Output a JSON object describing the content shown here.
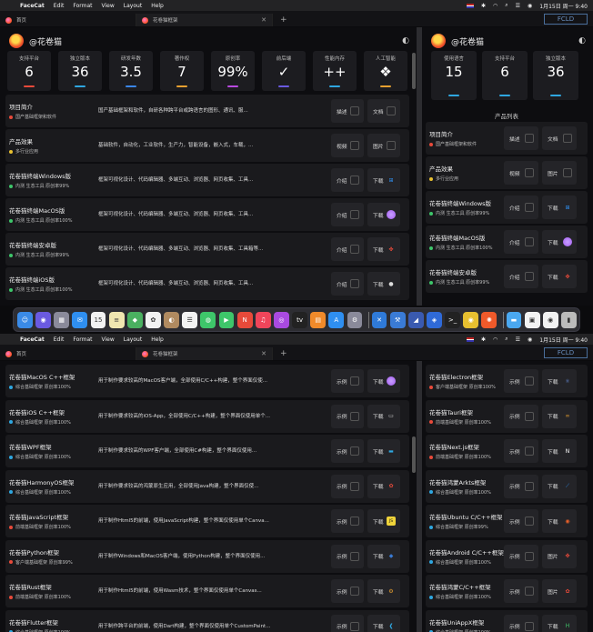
{
  "menubar": {
    "app": "FaceCat",
    "items": [
      "Edit",
      "Format",
      "View",
      "Layout",
      "Help"
    ],
    "time": "1月15日 周一 9:40"
  },
  "tabs": [
    {
      "label": "首页"
    },
    {
      "label": "花卷猫框架"
    }
  ],
  "titlelogo": "FCLD",
  "user": {
    "name": "@花卷猫"
  },
  "stats_left": [
    {
      "label": "支持平台",
      "value": "6",
      "color": "#e84a3a"
    },
    {
      "label": "独立版本",
      "value": "36",
      "color": "#2fa7e0"
    },
    {
      "label": "研发年数",
      "value": "3.5",
      "color": "#3a86e8"
    },
    {
      "label": "著作权",
      "value": "7",
      "color": "#e8a030"
    },
    {
      "label": "原创率",
      "value": "99%",
      "color": "#b94ae0"
    },
    {
      "label": "前后端",
      "value": "✓",
      "color": "#6a5ae0"
    },
    {
      "label": "性能内存",
      "value": "++",
      "color": "#2fa7e0"
    },
    {
      "label": "人工智能",
      "value": "❖",
      "color": "#e8a030"
    }
  ],
  "stats_right": [
    {
      "label": "使用语言",
      "value": "15",
      "color": "#2fa7e0"
    },
    {
      "label": "支持平台",
      "value": "6",
      "color": "#2fa7e0"
    },
    {
      "label": "独立版本",
      "value": "36",
      "color": "#2fa7e0"
    }
  ],
  "product_list_title": "产品列表",
  "rows_top": [
    {
      "title": "项目简介",
      "sub": "国产基础框架和软件",
      "dot": "#e84a3a",
      "desc": "国产基础框架和软件，自研各种跨平台或跨语言的图形、通讯、服...",
      "b1": "描述",
      "b2": "文档",
      "icon": "box",
      "icolor": "#555"
    },
    {
      "title": "产品效果",
      "sub": "多行业应用",
      "dot": "#e8c030",
      "desc": "基础软件，自动化，工业软件，生产力，智能设备，嵌入式，车载，...",
      "b1": "视频",
      "b2": "图片",
      "icon": "box",
      "icolor": "#555"
    },
    {
      "title": "花卷猫终端Windows版",
      "sub": "内测 生态工具 原创率99%",
      "dot": "#3ec66a",
      "desc": "框架可视化设计、代码编辑器、多端互动、浏览器、网页收集、工具...",
      "b1": "介绍",
      "b2": "下载",
      "icon": "win",
      "icolor": "#2f8ff0"
    },
    {
      "title": "花卷猫终端MacOS版",
      "sub": "内测 生态工具 原创率100%",
      "dot": "#3ec66a",
      "desc": "框架可视化设计、代码编辑器、多端互动、浏览器、网页收集、工具...",
      "b1": "介绍",
      "b2": "下载",
      "icon": "mac",
      "icolor": "#a45cf0"
    },
    {
      "title": "花卷猫终端安卓版",
      "sub": "内测 生态工具 原创率99%",
      "dot": "#3ec66a",
      "desc": "框架可视化设计、代码编辑器、多端互动、浏览器、网页收集、工具箱等...",
      "b1": "介绍",
      "b2": "下载",
      "icon": "android",
      "icolor": "#e84a3a"
    },
    {
      "title": "花卷猫终端iOS版",
      "sub": "内测 生态工具 原创率100%",
      "dot": "#3ec66a",
      "desc": "框架可视化设计、代码编辑器、多端互动、浏览器、网页收集、工具...",
      "b1": "介绍",
      "b2": "下载",
      "icon": "apple",
      "icolor": "#ddd"
    }
  ],
  "rows_top_right": [
    {
      "title": "项目简介",
      "sub": "国产基础框架和软件",
      "dot": "#e84a3a",
      "b1": "描述",
      "b2": "文档",
      "icon": "box",
      "icolor": "#555"
    },
    {
      "title": "产品效果",
      "sub": "多行业应用",
      "dot": "#e8c030",
      "b1": "视频",
      "b2": "图片",
      "icon": "box",
      "icolor": "#555"
    },
    {
      "title": "花卷猫终端Windows版",
      "sub": "内测 生态工具 原创率99%",
      "dot": "#3ec66a",
      "b1": "介绍",
      "b2": "下载",
      "icon": "win",
      "icolor": "#2f8ff0"
    },
    {
      "title": "花卷猫终端MacOS版",
      "sub": "内测 生态工具 原创率100%",
      "dot": "#3ec66a",
      "b1": "介绍",
      "b2": "下载",
      "icon": "mac",
      "icolor": "#a45cf0"
    },
    {
      "title": "花卷猫终端安卓版",
      "sub": "内测 生态工具 原创率99%",
      "dot": "#3ec66a",
      "b1": "介绍",
      "b2": "下载",
      "icon": "android",
      "icolor": "#e84a3a"
    }
  ],
  "rows_bottom": [
    {
      "title": "花卷猫MacOS C++框架",
      "sub": "综合基础框架 原创率100%",
      "dot": "#2fa7e0",
      "desc": "用于制作要求较高的MacOS客户端，全部使用C/C++构建，整个界面仅使...",
      "b1": "示例",
      "b2": "下载",
      "icon": "mac",
      "icolor": "#a45cf0"
    },
    {
      "title": "花卷猫iOS C++框架",
      "sub": "综合基础框架 原创率100%",
      "dot": "#2fa7e0",
      "desc": "用于制作要求较高的iOS-App，全部使用C/C++构建，整个界面仅使用单个...",
      "b1": "示例",
      "b2": "下载",
      "icon": "ios",
      "icolor": "#ddd"
    },
    {
      "title": "花卷猫WPF框架",
      "sub": "综合基础框架 原创率100%",
      "dot": "#2fa7e0",
      "desc": "用于制作要求较高的WPF客户端，全部使用C#构建，整个界面仅使用...",
      "b1": "示例",
      "b2": "下载",
      "icon": "wpf",
      "icolor": "#2fa7e0"
    },
    {
      "title": "花卷猫HarmonyOS框架",
      "sub": "综合基础框架 原创率100%",
      "dot": "#2fa7e0",
      "desc": "用于制作要求较高的鸿蒙原生应用，全部使用Java构建，整个界面仅使...",
      "b1": "示例",
      "b2": "下载",
      "icon": "harmony",
      "icolor": "#e84a3a"
    },
    {
      "title": "花卷猫JavaScript框架",
      "sub": "前端基础框架 原创率100%",
      "dot": "#e84a3a",
      "desc": "用于制作Html5的前端，使用JavaScript构建，整个界面仅使用单个Canva...",
      "b1": "示例",
      "b2": "下载",
      "icon": "js",
      "icolor": "#f0d43a"
    },
    {
      "title": "花卷猫Python框架",
      "sub": "客户端基础框架 原创率99%",
      "dot": "#e84a3a",
      "desc": "用于制作Windows和MacOS客户端，使用Python构建，整个界面仅使用...",
      "b1": "示例",
      "b2": "下载",
      "icon": "py",
      "icolor": "#3a7bd5"
    },
    {
      "title": "花卷猫Rust框架",
      "sub": "前端基础框架 原创率100%",
      "dot": "#e84a3a",
      "desc": "用于制作Html5的前端，使用Wasm技术，整个界面仅使用单个Canvas...",
      "b1": "示例",
      "b2": "下载",
      "icon": "rust",
      "icolor": "#e8a030"
    },
    {
      "title": "花卷猫Flutter框架",
      "sub": "综合基础框架 原创率100%",
      "dot": "#2fa7e0",
      "desc": "用于制作跨平台的前端，使用Dart构建，整个界面仅使用单个CustomPaint...",
      "b1": "示例",
      "b2": "下载",
      "icon": "flutter",
      "icolor": "#2fa7e0"
    }
  ],
  "rows_bottom_right": [
    {
      "title": "花卷猫Electron框架",
      "sub": "客户端基础框架 原创率100%",
      "dot": "#e84a3a",
      "b1": "示例",
      "b2": "下载",
      "icon": "electron",
      "icolor": "#6a8fe0"
    },
    {
      "title": "花卷猫Tauri框架",
      "sub": "前端基础框架 原创率100%",
      "dot": "#e84a3a",
      "b1": "示例",
      "b2": "下载",
      "icon": "tauri",
      "icolor": "#e8a030"
    },
    {
      "title": "花卷猫Next.js框架",
      "sub": "前端基础框架 原创率100%",
      "dot": "#e84a3a",
      "b1": "示例",
      "b2": "下载",
      "icon": "next",
      "icolor": "#ffffff"
    },
    {
      "title": "花卷猫鸿蒙Arkts框架",
      "sub": "综合基础框架 原创率100%",
      "dot": "#2fa7e0",
      "b1": "示例",
      "b2": "下载",
      "icon": "arkts",
      "icolor": "#2f8ff0"
    },
    {
      "title": "花卷猫Ubuntu C/C++框架",
      "sub": "综合基础框架 原创率99%",
      "dot": "#2fa7e0",
      "b1": "示例",
      "b2": "下载",
      "icon": "ubuntu",
      "icolor": "#e8602a"
    },
    {
      "title": "花卷猫Android C/C++框架",
      "sub": "综合基础框架 原创率100%",
      "dot": "#2fa7e0",
      "b1": "示例",
      "b2": "图片",
      "icon": "android",
      "icolor": "#e84a3a"
    },
    {
      "title": "花卷猫鸿蒙C/C++框架",
      "sub": "综合基础框架 原创率100%",
      "dot": "#2fa7e0",
      "b1": "示例",
      "b2": "图片",
      "icon": "harmony",
      "icolor": "#e84a3a"
    },
    {
      "title": "花卷猫UniAppX框架",
      "sub": "综合基础框架 原创率100%",
      "dot": "#2fa7e0",
      "b1": "示例",
      "b2": "下载",
      "icon": "uni",
      "icolor": "#3ec66a"
    }
  ],
  "dock": [
    {
      "name": "finder-icon",
      "color": "#3a8be8",
      "glyph": "☺"
    },
    {
      "name": "siri-icon",
      "color": "#6a5ae0",
      "glyph": "◉"
    },
    {
      "name": "launchpad-icon",
      "color": "#8a8a9a",
      "glyph": "▦"
    },
    {
      "name": "mail-icon",
      "color": "#2f8ff0",
      "glyph": "✉"
    },
    {
      "name": "calendar-icon",
      "color": "#f2f2f2",
      "glyph": "15"
    },
    {
      "name": "notes-icon",
      "color": "#f0e6b0",
      "glyph": "≡"
    },
    {
      "name": "maps-icon",
      "color": "#4ab060",
      "glyph": "◆"
    },
    {
      "name": "photos-icon",
      "color": "#f2f2f2",
      "glyph": "✿"
    },
    {
      "name": "contacts-icon",
      "color": "#b08a60",
      "glyph": "◐"
    },
    {
      "name": "reminders-icon",
      "color": "#f2f2f2",
      "glyph": "☰"
    },
    {
      "name": "messages-icon",
      "color": "#3ec66a",
      "glyph": "◍"
    },
    {
      "name": "facetime-icon",
      "color": "#3ec66a",
      "glyph": "▶"
    },
    {
      "name": "news-icon",
      "color": "#e84a3a",
      "glyph": "N"
    },
    {
      "name": "music-icon",
      "color": "#f0455a",
      "glyph": "♫"
    },
    {
      "name": "podcasts-icon",
      "color": "#a94ae0",
      "glyph": "◎"
    },
    {
      "name": "tv-icon",
      "color": "#222",
      "glyph": "tv"
    },
    {
      "name": "books-icon",
      "color": "#f08a2a",
      "glyph": "▤"
    },
    {
      "name": "appstore-icon",
      "color": "#2f8ff0",
      "glyph": "A"
    },
    {
      "name": "settings-icon",
      "color": "#8a8a9a",
      "glyph": "⚙"
    },
    {
      "name": "vscode-icon",
      "color": "#2f7ad8",
      "glyph": "✕"
    },
    {
      "name": "xcode-icon",
      "color": "#3a7bd5",
      "glyph": "⚒"
    },
    {
      "name": "instruments-icon",
      "color": "#3a5ab0",
      "glyph": "◢"
    },
    {
      "name": "location-icon",
      "color": "#2f6ad8",
      "glyph": "◈"
    },
    {
      "name": "terminal-icon",
      "color": "#222",
      "glyph": ">_"
    },
    {
      "name": "chrome-icon",
      "color": "#e8c030",
      "glyph": "◉"
    },
    {
      "name": "facecat-icon",
      "color": "#f05a2a",
      "glyph": "✺"
    },
    {
      "name": "folder-icon",
      "color": "#4aa8f0",
      "glyph": "▬"
    },
    {
      "name": "preview-icon",
      "color": "#f2f2f2",
      "glyph": "▣"
    },
    {
      "name": "chrome2-icon",
      "color": "#f2f2f2",
      "glyph": "◉"
    },
    {
      "name": "trash-icon",
      "color": "#bbb",
      "glyph": "▮"
    }
  ]
}
